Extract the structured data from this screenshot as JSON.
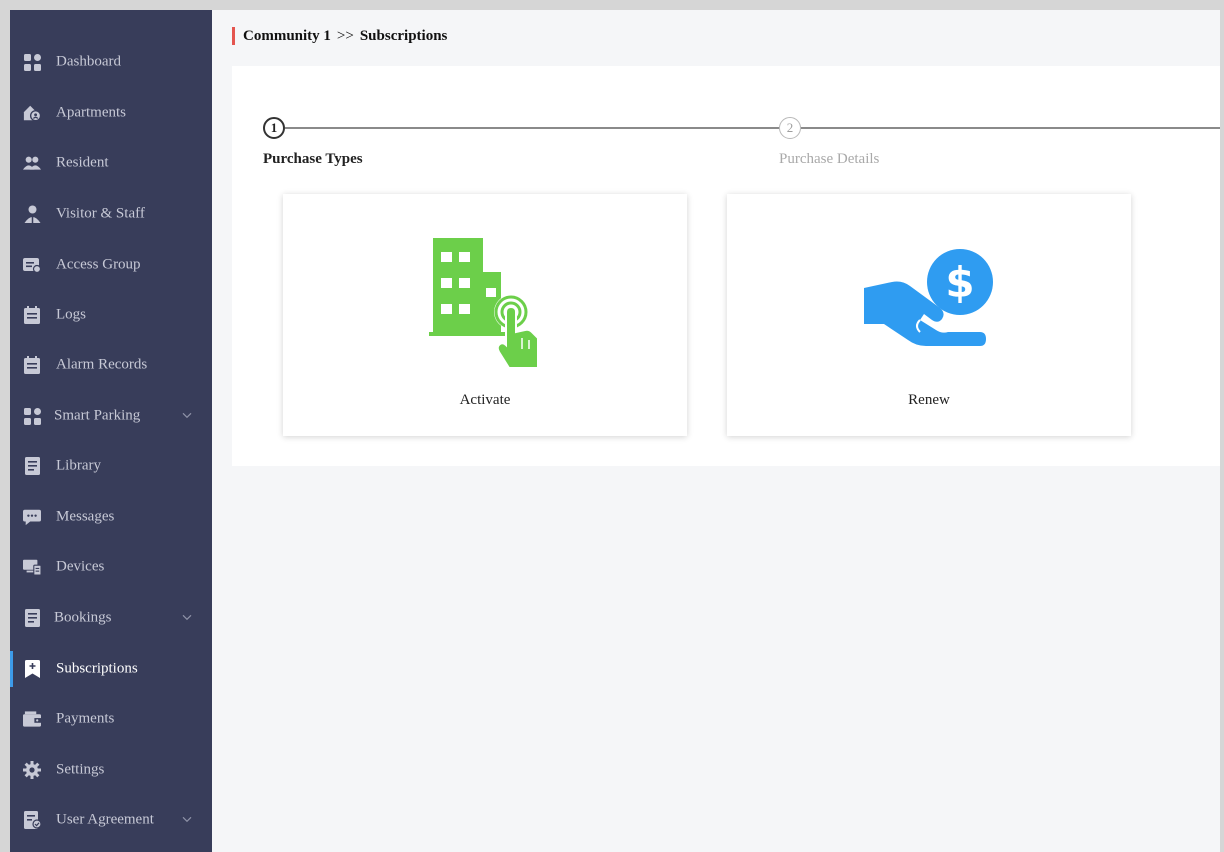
{
  "breadcrumb": {
    "root": "Community 1",
    "separator": ">>",
    "current": "Subscriptions"
  },
  "sidebar": {
    "items": [
      {
        "label": "Dashboard",
        "icon": "dashboard-icon"
      },
      {
        "label": "Apartments",
        "icon": "apartments-icon"
      },
      {
        "label": "Resident",
        "icon": "resident-icon"
      },
      {
        "label": "Visitor & Staff",
        "icon": "visitor-staff-icon"
      },
      {
        "label": "Access Group",
        "icon": "access-group-icon"
      },
      {
        "label": "Logs",
        "icon": "logs-icon"
      },
      {
        "label": "Alarm Records",
        "icon": "alarm-records-icon"
      },
      {
        "label": "Smart Parking",
        "icon": "smart-parking-icon",
        "expandable": true
      },
      {
        "label": "Library",
        "icon": "library-icon"
      },
      {
        "label": "Messages",
        "icon": "messages-icon"
      },
      {
        "label": "Devices",
        "icon": "devices-icon"
      },
      {
        "label": "Bookings",
        "icon": "bookings-icon",
        "expandable": true
      },
      {
        "label": "Subscriptions",
        "icon": "subscriptions-icon",
        "active": true
      },
      {
        "label": "Payments",
        "icon": "payments-icon"
      },
      {
        "label": "Settings",
        "icon": "settings-icon"
      },
      {
        "label": "User Agreement",
        "icon": "user-agreement-icon",
        "expandable": true
      }
    ]
  },
  "steps": [
    {
      "number": "1",
      "label": "Purchase Types",
      "state": "active"
    },
    {
      "number": "2",
      "label": "Purchase Details",
      "state": "inactive"
    }
  ],
  "cards": [
    {
      "label": "Activate",
      "icon": "building-tap-icon",
      "color": "#6ccf4a"
    },
    {
      "label": "Renew",
      "icon": "hand-dollar-icon",
      "color": "#2f9cf1"
    }
  ],
  "colors": {
    "sidebar_bg": "#383d5a",
    "sidebar_text": "#c7c9d6",
    "active_indicator": "#3d9be9",
    "breadcrumb_accent": "#e4554f",
    "main_bg": "#f5f6f8"
  }
}
